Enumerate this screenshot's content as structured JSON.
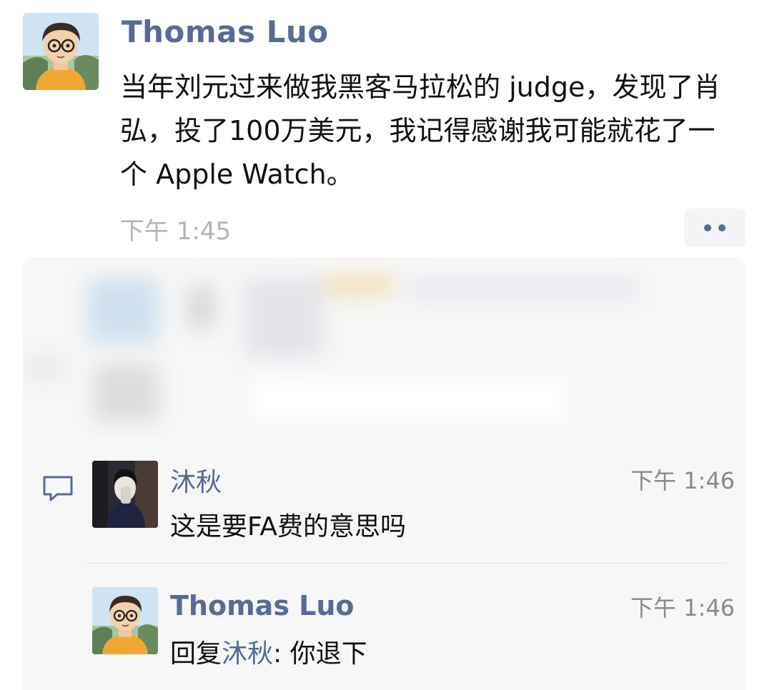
{
  "post": {
    "author": "Thomas Luo",
    "text": "当年刘元过来做我黑客马拉松的 judge，发现了肖弘，投了100万美元，我记得感谢我可能就花了一个 Apple Watch。",
    "time": "下午 1:45",
    "more_icon": "ellipsis-icon"
  },
  "comments": [
    {
      "author": "沐秋",
      "time": "下午 1:46",
      "text": "这是要FA费的意思吗"
    },
    {
      "author": "Thomas Luo",
      "time": "下午 1:46",
      "reply_prefix": "回复",
      "reply_to": "沐秋",
      "reply_sep": ": ",
      "text": "你退下"
    }
  ],
  "icons": {
    "comment": "comment-bubble-icon"
  },
  "colors": {
    "link": "#576b95",
    "text": "#111111",
    "muted": "#b4b4b4",
    "panel": "#f7f7f7"
  }
}
